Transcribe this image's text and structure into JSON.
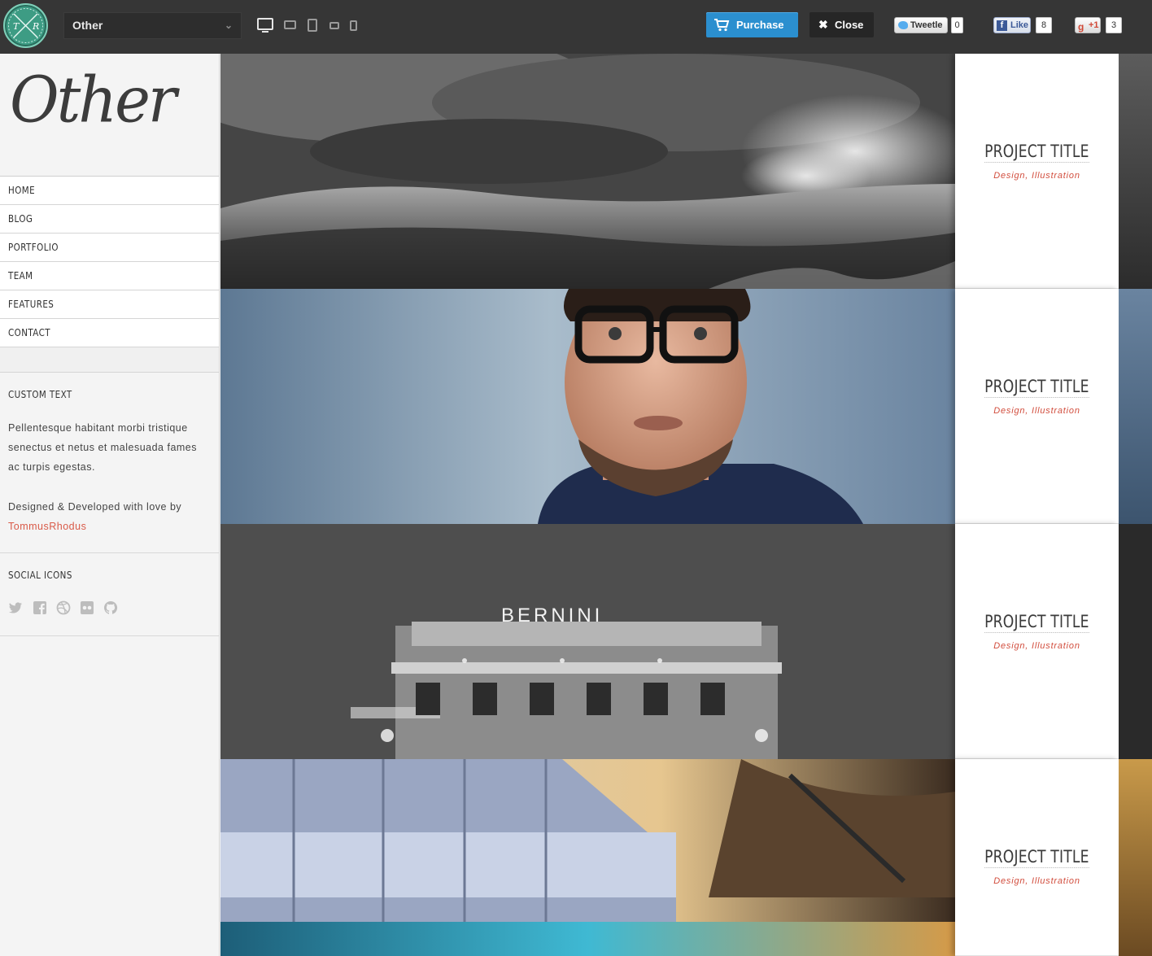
{
  "topbar": {
    "logo_letters": [
      "T",
      "R"
    ],
    "theme_select": {
      "value": "Other",
      "icon": "chevron-down-icon"
    },
    "device_icons": [
      "desktop-icon",
      "laptop-icon",
      "tablet-portrait-icon",
      "tablet-landscape-icon",
      "phone-icon"
    ],
    "purchase_label": "Purchase",
    "close_label": "Close",
    "tweet": {
      "label": "Tweetle",
      "count": "0"
    },
    "like": {
      "label": "Like",
      "count": "8"
    },
    "plusone": {
      "label": "+1",
      "count": "3"
    }
  },
  "sidebar": {
    "brand": "Other",
    "nav": [
      "HOME",
      "BLOG",
      "PORTFOLIO",
      "TEAM",
      "FEATURES",
      "CONTACT"
    ],
    "custom_text": {
      "title": "CUSTOM TEXT",
      "body": "Pellentesque habitant morbi tristique senectus et netus et malesuada fames ac turpis egestas.",
      "credit": "Designed & Developed with love by",
      "author": "TommusRhodus"
    },
    "social": {
      "title": "SOCIAL ICONS",
      "icons": [
        "twitter-icon",
        "facebook-icon",
        "dribbble-icon",
        "flickr-icon",
        "github-icon"
      ]
    }
  },
  "projects": [
    {
      "title": "PROJECT TITLE",
      "categories": "Design, Illustration",
      "image": "stormy-hills-photo"
    },
    {
      "title": "PROJECT TITLE",
      "categories": "Design, Illustration",
      "image": "man-glasses-portrait"
    },
    {
      "title": "PROJECT TITLE",
      "categories": "Design, Illustration",
      "image": "bernini-building-photo",
      "sign_text": "BERNINI"
    },
    {
      "title": "PROJECT TITLE",
      "categories": "Design, Illustration",
      "image": "river-boat-night-photo"
    }
  ],
  "colors": {
    "topbar": "#363636",
    "purchase": "#2b8fcf",
    "accent": "#d24e3e",
    "logo_badge": "#3d9c84"
  }
}
